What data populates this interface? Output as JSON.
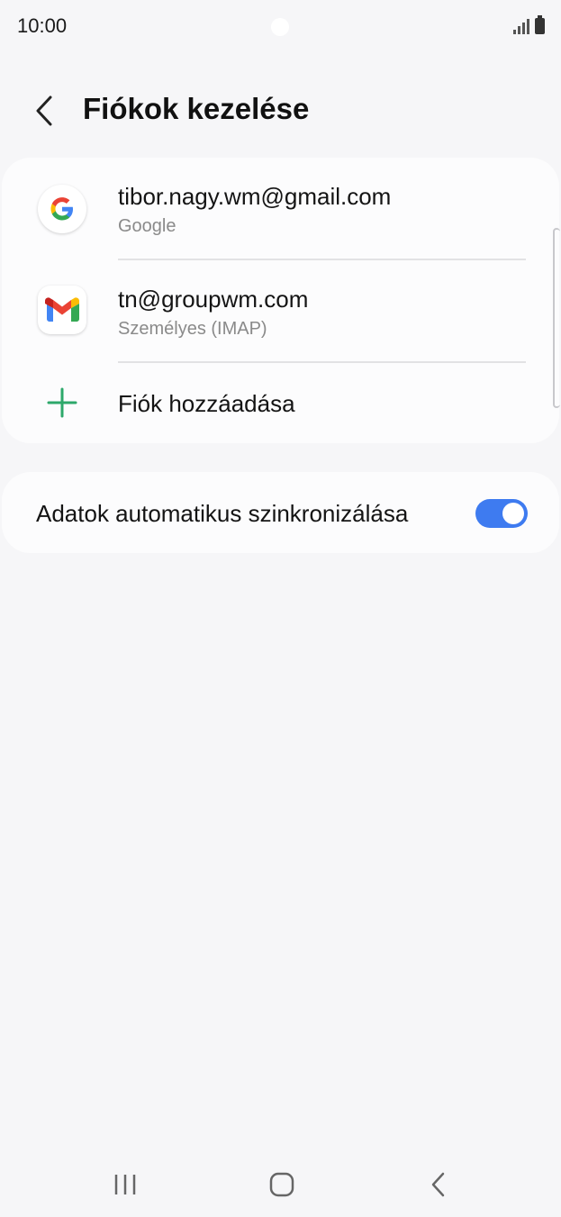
{
  "status_bar": {
    "time": "10:00",
    "icons": [
      "camera-dot",
      "signal-icon",
      "battery-icon"
    ]
  },
  "header": {
    "back_icon": "back-chevron-icon",
    "title": "Fiókok kezelése"
  },
  "accounts": [
    {
      "email": "tibor.nagy.wm@gmail.com",
      "type": "Google",
      "icon": "google-icon"
    },
    {
      "email": "tn@groupwm.com",
      "type": "Személyes (IMAP)",
      "icon": "gmail-icon"
    }
  ],
  "add_account": {
    "label": "Fiók hozzáadása",
    "icon": "plus-icon",
    "color": "#2da86a"
  },
  "sync": {
    "label": "Adatok automatikus szinkronizálása",
    "enabled": true,
    "toggle_color": "#3e7bf0"
  },
  "nav_bar": {
    "recents_icon": "recent-apps-icon",
    "home_icon": "home-icon",
    "back_icon": "back-icon"
  }
}
